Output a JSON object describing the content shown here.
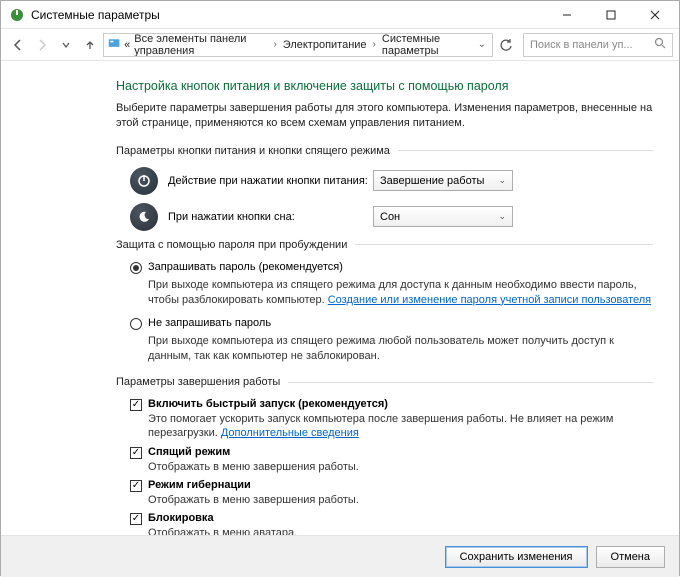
{
  "window": {
    "title": "Системные параметры"
  },
  "breadcrumb": {
    "item1": "Все элементы панели управления",
    "item2": "Электропитание",
    "item3": "Системные параметры"
  },
  "search": {
    "placeholder": "Поиск в панели уп..."
  },
  "page": {
    "heading": "Настройка кнопок питания и включение защиты с помощью пароля",
    "intro": "Выберите параметры завершения работы для этого компьютера. Изменения параметров, внесенные на этой странице, применяются ко всем схемам управления питанием."
  },
  "section1": {
    "title": "Параметры кнопки питания и кнопки спящего режима",
    "row1_label": "Действие при нажатии кнопки питания:",
    "row1_value": "Завершение работы",
    "row2_label": "При нажатии кнопки сна:",
    "row2_value": "Сон"
  },
  "section2": {
    "title": "Защита с помощью пароля при пробуждении",
    "opt1_label": "Запрашивать пароль (рекомендуется)",
    "opt1_desc_a": "При выходе компьютера из спящего режима для доступа к данным необходимо ввести пароль, чтобы разблокировать компьютер. ",
    "opt1_link": "Создание или изменение пароля учетной записи пользователя",
    "opt2_label": "Не запрашивать пароль",
    "opt2_desc": "При выходе компьютера из спящего режима любой пользователь может получить доступ к данным, так как компьютер не заблокирован."
  },
  "section3": {
    "title": "Параметры завершения работы",
    "c1_label": "Включить быстрый запуск (рекомендуется)",
    "c1_desc_a": "Это помогает ускорить запуск компьютера после завершения работы. Не влияет на режим перезагрузки. ",
    "c1_link": "Дополнительные сведения",
    "c2_label": "Спящий режим",
    "c2_desc": "Отображать в меню завершения работы.",
    "c3_label": "Режим гибернации",
    "c3_desc": "Отображать в меню завершения работы.",
    "c4_label": "Блокировка",
    "c4_desc": "Отображать в меню аватара."
  },
  "footer": {
    "save": "Сохранить изменения",
    "cancel": "Отмена"
  }
}
